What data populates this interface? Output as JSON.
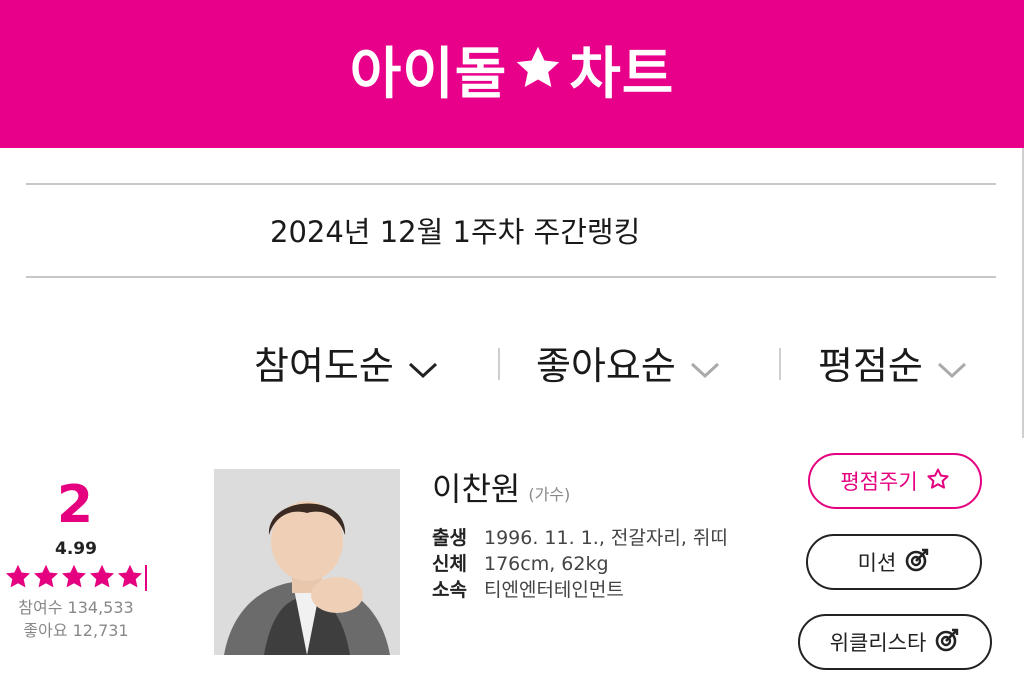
{
  "header": {
    "logo_left": "아이돌",
    "logo_right": "차트",
    "brand_color": "#e9008a",
    "logo_icon": "star-icon"
  },
  "week": {
    "title": "2024년 12월 1주차 주간랭킹"
  },
  "sort": {
    "items": [
      {
        "label": "참여도순",
        "icon": "chevron-down-icon",
        "active": true
      },
      {
        "label": "좋아요순",
        "icon": "chevron-down-icon",
        "active": false
      },
      {
        "label": "평점순",
        "icon": "chevron-down-icon",
        "active": false
      }
    ]
  },
  "entry": {
    "rank": "2",
    "score": "4.99",
    "stars_filled": 5,
    "participation": "참여수 134,533",
    "likes": "좋아요 12,731",
    "name": "이찬원",
    "job": "(가수)",
    "info": [
      {
        "key": "출생",
        "value": "1996. 11. 1., 전갈자리, 쥐띠"
      },
      {
        "key": "신체",
        "value": "176cm, 62kg"
      },
      {
        "key": "소속",
        "value": "티엔엔터테인먼트"
      }
    ],
    "accent_color": "#e5007f"
  },
  "buttons": {
    "rate": {
      "label": "평점주기",
      "icon": "star-outline-icon"
    },
    "mission": {
      "label": "미션",
      "icon": "target-icon"
    },
    "weekly": {
      "label": "위클리스타",
      "icon": "target-icon"
    }
  }
}
